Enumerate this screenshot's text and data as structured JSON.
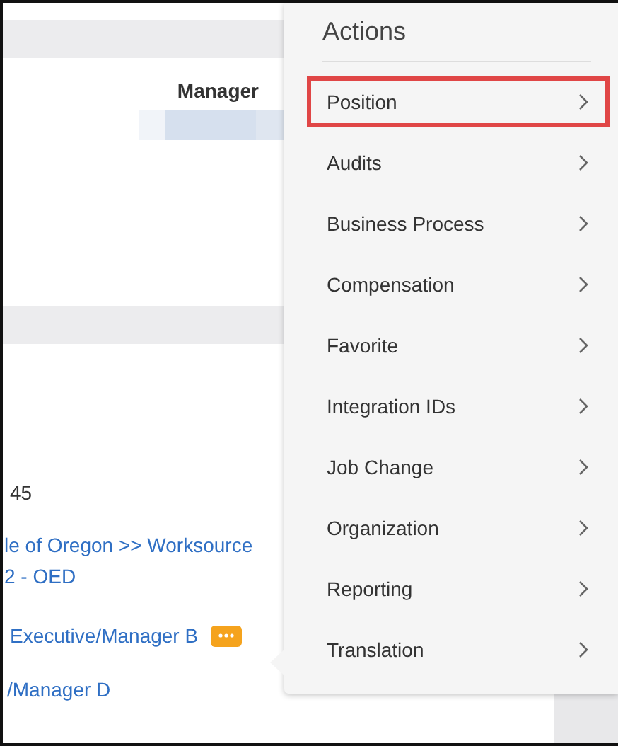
{
  "page": {
    "column_header": "Manager",
    "number": "45",
    "org_link": "le of Oregon >> Worksource\n2 - OED",
    "manager_link": "Executive/Manager B",
    "next_manager": "/Manager D"
  },
  "menu": {
    "title": "Actions",
    "items": [
      {
        "label": "Position",
        "selected": true
      },
      {
        "label": "Audits",
        "selected": false
      },
      {
        "label": "Business Process",
        "selected": false
      },
      {
        "label": "Compensation",
        "selected": false
      },
      {
        "label": "Favorite",
        "selected": false
      },
      {
        "label": "Integration IDs",
        "selected": false
      },
      {
        "label": "Job Change",
        "selected": false
      },
      {
        "label": "Organization",
        "selected": false
      },
      {
        "label": "Reporting",
        "selected": false
      },
      {
        "label": "Translation",
        "selected": false
      }
    ]
  }
}
